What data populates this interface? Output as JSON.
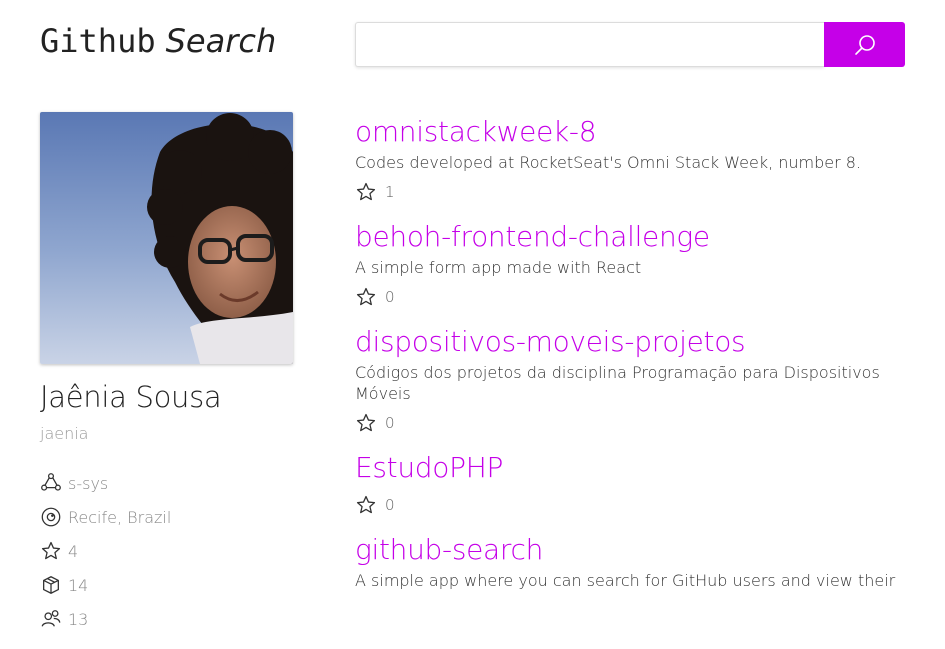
{
  "header": {
    "logo_main": "Github",
    "logo_sub": "Search",
    "search": {
      "value": "",
      "placeholder": ""
    },
    "search_button_icon": "search-icon",
    "accent_color": "#c500e8"
  },
  "profile": {
    "name": "Jaênia Sousa",
    "login": "jaenia",
    "company": "s-sys",
    "location": "Recife, Brazil",
    "stars": "4",
    "repositories": "14",
    "following": "13"
  },
  "repos": [
    {
      "name": "omnistackweek-8",
      "description": "Codes developed at RocketSeat's Omni Stack Week, number 8.",
      "stars": "1"
    },
    {
      "name": "behoh-frontend-challenge",
      "description": "A simple form app made with React",
      "stars": "0"
    },
    {
      "name": "dispositivos-moveis-projetos",
      "description": "Códigos dos projetos da disciplina Programação para Dispositivos Móveis",
      "stars": "0"
    },
    {
      "name": "EstudoPHP",
      "description": "",
      "stars": "0"
    },
    {
      "name": "github-search",
      "description": "A simple app where you can search for GitHub users and view their",
      "stars": ""
    }
  ]
}
